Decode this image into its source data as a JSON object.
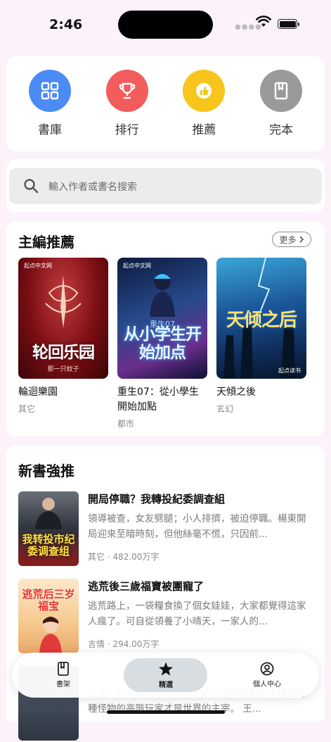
{
  "status": {
    "time": "2:46"
  },
  "quick_nav": [
    {
      "label": "書庫",
      "icon": "library-grid-icon",
      "color": "#4a8bf5"
    },
    {
      "label": "排行",
      "icon": "trophy-icon",
      "color": "#f25c5c"
    },
    {
      "label": "推薦",
      "icon": "thumbs-up-icon",
      "color": "#f7c51c"
    },
    {
      "label": "完本",
      "icon": "book-icon",
      "color": "#9a9a9a"
    }
  ],
  "search": {
    "placeholder": "輸入作者或書名搜索"
  },
  "editor_picks": {
    "title": "主編推薦",
    "more_label": "更多",
    "books": [
      {
        "title": "輪迴樂園",
        "genre": "其它",
        "cover_text": "轮回乐园",
        "cover_author": "那一只蚊子",
        "cover_pub": "起点中文网"
      },
      {
        "title": "重生07：從小學生開始加點",
        "genre": "都市",
        "cover_text": "从小学生开始加点",
        "cover_sub": "重生07",
        "cover_pub": "起点中文网"
      },
      {
        "title": "天傾之後",
        "genre": "玄幻",
        "cover_text": "天倾之后",
        "cover_pub": "起点读书"
      }
    ]
  },
  "new_books": {
    "title": "新書強推",
    "books": [
      {
        "title": "開局停職？我轉投紀委調查組",
        "desc": "領導被查，女友劈腿；小人排擠，被迫停職。楊東開局迎來至暗時刻，但他絲毫不慌，只因前...",
        "meta": "其它 · 482.00万字",
        "cover_text": "我转投市纪委调查组"
      },
      {
        "title": "逃荒後三歲福寶被團寵了",
        "desc": "逃荒路上，一袋糧食換了個女娃娃，大家都覺得這家人瘋了。可自從領養了小晴天，一家人的...",
        "meta": "言情 · 294.00万字",
        "cover_text": "逃荒后三岁福宝"
      },
      {
        "title": "",
        "desc": "這是一個全民玩家的世界，六月過關無數副本殺盡各種怪物的高階玩家才是世界的主宰。 王...",
        "meta": "",
        "cover_text": ""
      }
    ]
  },
  "tabbar": {
    "items": [
      {
        "label": "書架",
        "icon": "bookshelf-icon"
      },
      {
        "label": "精選",
        "icon": "star-icon",
        "active": true
      },
      {
        "label": "個人中心",
        "icon": "user-circle-icon"
      }
    ]
  }
}
